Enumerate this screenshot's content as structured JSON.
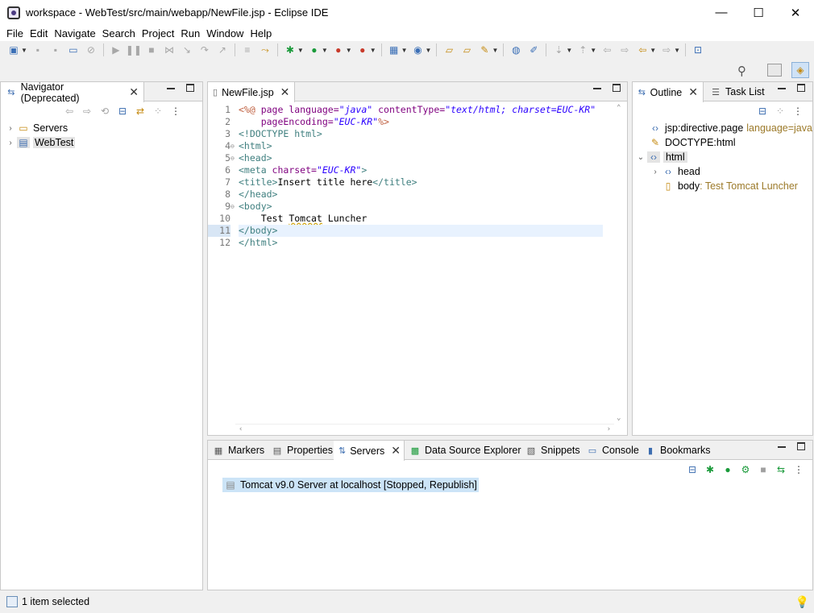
{
  "window": {
    "title": "workspace - WebTest/src/main/webapp/NewFile.jsp - Eclipse IDE",
    "minimize": "—",
    "maximize": "☐",
    "close": "✕"
  },
  "menu": [
    "File",
    "Edit",
    "Navigate",
    "Search",
    "Project",
    "Run",
    "Window",
    "Help"
  ],
  "navigator": {
    "tab_label": "Navigator (Deprecated)",
    "items": [
      {
        "label": "Servers",
        "icon": "folder-icon"
      },
      {
        "label": "WebTest",
        "icon": "project-icon"
      }
    ]
  },
  "editor": {
    "tab_label": "NewFile.jsp",
    "lines": [
      "1",
      "2",
      "3",
      "4",
      "5",
      "6",
      "7",
      "8",
      "9",
      "10",
      "11",
      "12"
    ],
    "code": {
      "l1_open": "<%@",
      "l1_page": " page ",
      "l1_lang_attr": "language=",
      "l1_lang_val": "\"java\"",
      "l1_ct_attr": " contentType=",
      "l1_ct_val": "\"text/html; charset=EUC-KR\"",
      "l2_pe_attr": "    pageEncoding=",
      "l2_pe_val": "\"EUC-KR\"",
      "l2_close": "%>",
      "l3": "<!DOCTYPE html>",
      "l4": "<html>",
      "l5": "<head>",
      "l6_open": "<meta ",
      "l6_attr": "charset=",
      "l6_val": "\"EUC-KR\"",
      "l6_close": ">",
      "l7_open": "<title>",
      "l7_text": "Insert title here",
      "l7_close": "</title>",
      "l8": "</head>",
      "l9": "<body>",
      "l10_pre": "    Test ",
      "l10_squig": "Tomcat",
      "l10_post": " Luncher",
      "l11": "</body>",
      "l12": "</html>"
    }
  },
  "outline": {
    "tab_label": "Outline",
    "task_tab_label": "Task List",
    "items": [
      {
        "label": "jsp:directive.page",
        "detail": "language=java"
      },
      {
        "label": "DOCTYPE:html",
        "detail": ""
      },
      {
        "label": "html",
        "detail": ""
      },
      {
        "label": "head",
        "detail": ""
      },
      {
        "label": "body",
        "detail": " : Test Tomcat Luncher"
      }
    ]
  },
  "bottom": {
    "tabs": [
      "Markers",
      "Properties",
      "Servers",
      "Data Source Explorer",
      "Snippets",
      "Console",
      "Bookmarks"
    ],
    "server_entry": "Tomcat v9.0 Server at localhost  [Stopped, Republish]"
  },
  "status": {
    "text": "1 item selected"
  }
}
